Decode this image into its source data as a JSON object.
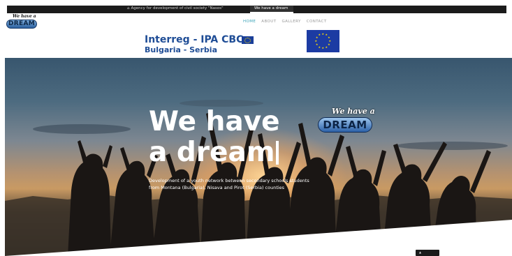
{
  "topbar": {
    "agency_icon": "home-icon",
    "agency_text": "Agency for development of civil society \"Nasos\"",
    "site_tag": "We have a dream"
  },
  "logo": {
    "script": "We have a",
    "word": "DREAM"
  },
  "nav": {
    "items": [
      "HOME",
      "ABOUT",
      "GALLERY",
      "CONTACT"
    ],
    "active_index": 0
  },
  "interreg": {
    "line1": "Interreg - IPA CBC",
    "line2": "Bulgaria - Serbia"
  },
  "hero": {
    "title_line1": "We have",
    "title_line2": "a dream",
    "description": "Development of a youth network between secondary schools students from Montana (Bulgaria), Nisava and Pirot (Serbia) counties",
    "logo_script": "We have a",
    "logo_word": "DREAM"
  },
  "colors": {
    "nav_active": "#3aa3b8",
    "interreg_blue": "#1f4d96",
    "eu_blue": "#1c3ba3",
    "topbar": "#1b1b1b"
  }
}
